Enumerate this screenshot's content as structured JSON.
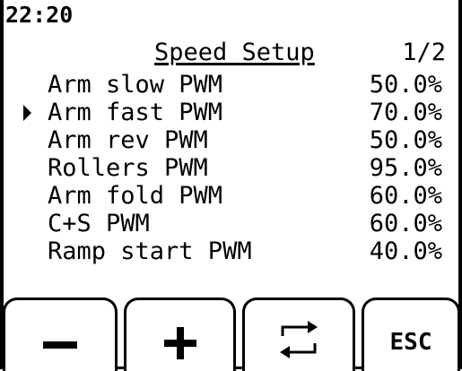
{
  "status": {
    "time": "22:20"
  },
  "header": {
    "title": "Speed Setup",
    "page_indicator": "1/2"
  },
  "settings": [
    {
      "label": "Arm slow PWM",
      "value": "50.0%",
      "selected": false
    },
    {
      "label": "Arm fast PWM",
      "value": "70.0%",
      "selected": true
    },
    {
      "label": "Arm rev PWM",
      "value": "50.0%",
      "selected": false
    },
    {
      "label": "Rollers PWM",
      "value": "95.0%",
      "selected": false
    },
    {
      "label": "Arm fold PWM",
      "value": "60.0%",
      "selected": false
    },
    {
      "label": "C+S PWM",
      "value": "60.0%",
      "selected": false
    },
    {
      "label": "Ramp start PWM",
      "value": "40.0%",
      "selected": false
    }
  ],
  "softkeys": {
    "minus_icon": "minus-icon",
    "plus_icon": "plus-icon",
    "cycle_icon": "cycle-arrows-icon",
    "esc_label": "ESC"
  },
  "colors": {
    "foreground": "#000000",
    "background": "#ffffff"
  }
}
